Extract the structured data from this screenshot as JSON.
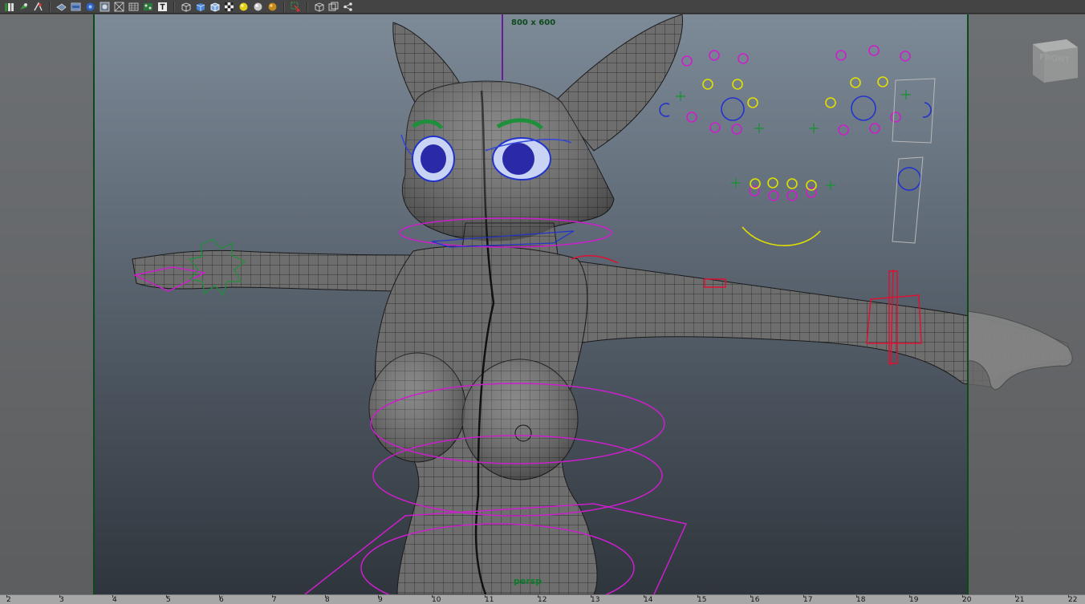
{
  "viewport": {
    "resolution_label": "800 x 600",
    "camera_name": "persp",
    "viewcube_label": "FRONT"
  },
  "colors": {
    "toolbar_bg": "#444444",
    "gate_line": "#0d4a1b",
    "nurbs_curve": "#cc1fcc",
    "face_control": "#e0e000",
    "eye_ctrl_blue": "#2233cc",
    "joint_red": "#dd1133",
    "wrist_green": "#1e8f3a"
  },
  "toolbar": {
    "icons": [
      "select-camera-icon",
      "camera-attributes-icon",
      "bookmark-icon",
      "grid-icon",
      "film-gate-icon",
      "resolution-gate-icon",
      "wireframe-icon",
      "smooth-shade-icon",
      "xray-icon",
      "isolate-icon",
      "text-icon",
      "cube-wire-icon",
      "cube-shaded-icon",
      "cube-wire-on-shaded-icon",
      "texture-checker-icon",
      "default-light-icon",
      "all-lights-icon",
      "shadows-icon",
      "select-highlight-icon",
      "isolate-select-icon",
      "cube-frame-icon",
      "pivot-icon"
    ]
  },
  "timeline": {
    "ticks": [
      "2",
      "3",
      "4",
      "5",
      "6",
      "7",
      "8",
      "9",
      "10",
      "11",
      "12",
      "13",
      "14",
      "15",
      "16",
      "17",
      "18",
      "19",
      "20",
      "21",
      "22"
    ]
  }
}
